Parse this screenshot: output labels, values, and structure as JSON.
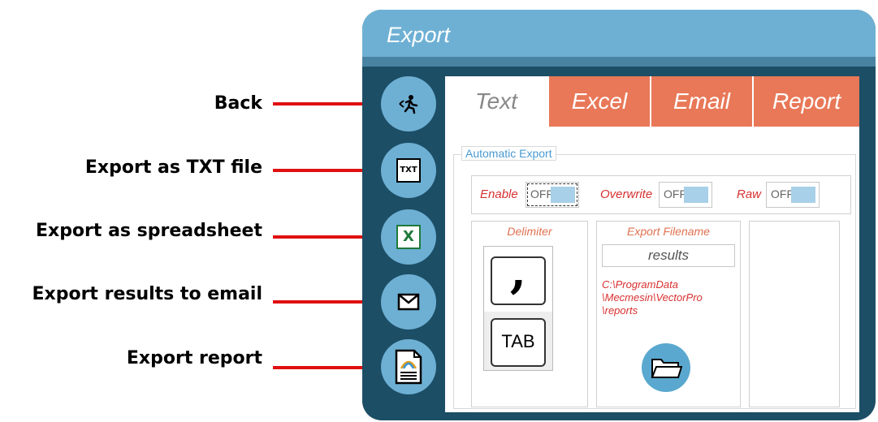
{
  "callouts": [
    {
      "label": "Back"
    },
    {
      "label": "Export as TXT file"
    },
    {
      "label": "Export as spreadsheet"
    },
    {
      "label": "Export results to email"
    },
    {
      "label": "Export report"
    }
  ],
  "window": {
    "title": "Export"
  },
  "side_buttons": [
    {
      "icon": "back-runner-icon"
    },
    {
      "icon": "txt-file-icon",
      "text": "TXT"
    },
    {
      "icon": "excel-icon",
      "text": "X"
    },
    {
      "icon": "email-envelope-icon"
    },
    {
      "icon": "report-document-icon"
    }
  ],
  "tabs": [
    {
      "label": "Text",
      "active": true
    },
    {
      "label": "Excel",
      "active": false
    },
    {
      "label": "Email",
      "active": false
    },
    {
      "label": "Report",
      "active": false
    }
  ],
  "auto_export": {
    "legend": "Automatic Export",
    "toggles": [
      {
        "label": "Enable",
        "state": "OFF"
      },
      {
        "label": "Overwrite",
        "state": "OFF"
      },
      {
        "label": "Raw",
        "state": "OFF"
      }
    ]
  },
  "delimiter": {
    "title": "Delimiter",
    "comma": ",",
    "tab": "TAB"
  },
  "filename": {
    "title": "Export Filename",
    "value": "results",
    "path_lines": [
      "C:\\ProgramData",
      "\\Mecmesin\\VectorPro",
      "\\reports"
    ]
  },
  "colors": {
    "accent": "#6eb0d4",
    "window_bg": "#1c4e66",
    "tab_inactive": "#e87858",
    "callout_line": "#e01010"
  }
}
